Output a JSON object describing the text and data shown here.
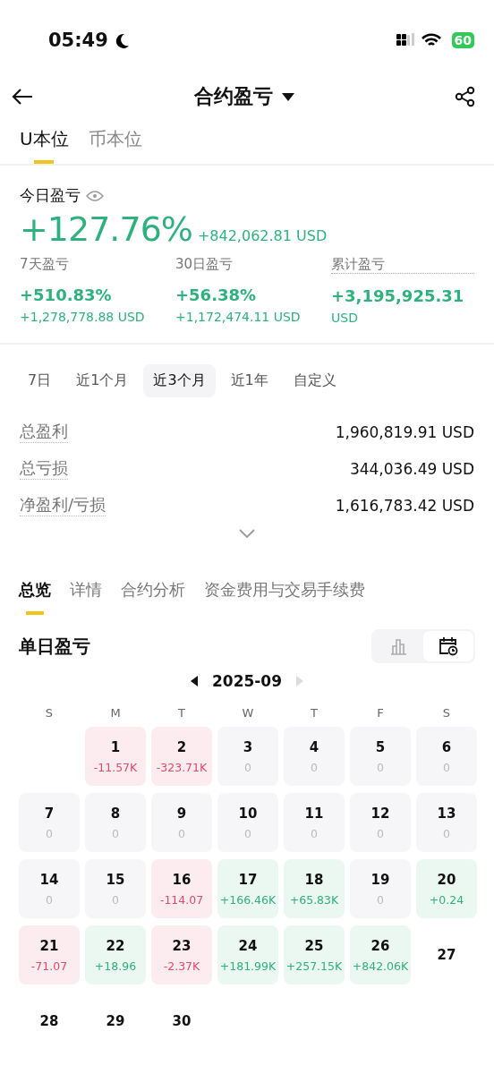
{
  "status_bar": {
    "time": "05:49",
    "battery": "60"
  },
  "header": {
    "title": "合约盈亏"
  },
  "unit_tabs": [
    {
      "label": "U本位",
      "selected": true
    },
    {
      "label": "币本位",
      "selected": false
    }
  ],
  "today": {
    "label": "今日盈亏",
    "percent": "+127.76%",
    "amount": "+842,062.81 USD"
  },
  "periods": [
    {
      "label": "7天盈亏",
      "value": "+510.83%",
      "sub": "+1,278,778.88 USD",
      "hint": false
    },
    {
      "label": "30日盈亏",
      "value": "+56.38%",
      "sub": "+1,172,474.11 USD",
      "hint": false
    },
    {
      "label": "累计盈亏",
      "value": "+3,195,925.31",
      "sub": "USD",
      "hint": true
    }
  ],
  "ranges": [
    {
      "label": "7日",
      "selected": false
    },
    {
      "label": "近1个月",
      "selected": false
    },
    {
      "label": "近3个月",
      "selected": true
    },
    {
      "label": "近1年",
      "selected": false
    },
    {
      "label": "自定义",
      "selected": false
    }
  ],
  "totals": [
    {
      "label": "总盈利",
      "value": "1,960,819.91 USD"
    },
    {
      "label": "总亏损",
      "value": "344,036.49 USD"
    },
    {
      "label": "净盈利/亏损",
      "value": "1,616,783.42 USD"
    }
  ],
  "section_tabs": [
    {
      "label": "总览",
      "selected": true
    },
    {
      "label": "详情",
      "selected": false
    },
    {
      "label": "合约分析",
      "selected": false
    },
    {
      "label": "资金费用与交易手续费",
      "selected": false
    }
  ],
  "daily": {
    "title": "单日盈亏",
    "views": [
      {
        "kind": "bar",
        "selected": false
      },
      {
        "kind": "calendar",
        "selected": true
      }
    ],
    "month": "2025-09",
    "weekdays": [
      "S",
      "M",
      "T",
      "W",
      "T",
      "F",
      "S"
    ],
    "days": [
      {
        "kind": "blank"
      },
      {
        "kind": "loss",
        "day": "1",
        "value": "-11.57K"
      },
      {
        "kind": "loss",
        "day": "2",
        "value": "-323.71K"
      },
      {
        "kind": "flat",
        "day": "3",
        "value": "0"
      },
      {
        "kind": "flat",
        "day": "4",
        "value": "0"
      },
      {
        "kind": "flat",
        "day": "5",
        "value": "0"
      },
      {
        "kind": "flat",
        "day": "6",
        "value": "0"
      },
      {
        "kind": "flat",
        "day": "7",
        "value": "0"
      },
      {
        "kind": "flat",
        "day": "8",
        "value": "0"
      },
      {
        "kind": "flat",
        "day": "9",
        "value": "0"
      },
      {
        "kind": "flat",
        "day": "10",
        "value": "0"
      },
      {
        "kind": "flat",
        "day": "11",
        "value": "0"
      },
      {
        "kind": "flat",
        "day": "12",
        "value": "0"
      },
      {
        "kind": "flat",
        "day": "13",
        "value": "0"
      },
      {
        "kind": "flat",
        "day": "14",
        "value": "0"
      },
      {
        "kind": "flat",
        "day": "15",
        "value": "0"
      },
      {
        "kind": "loss",
        "day": "16",
        "value": "-114.07"
      },
      {
        "kind": "gain",
        "day": "17",
        "value": "+166.46K"
      },
      {
        "kind": "gain",
        "day": "18",
        "value": "+65.83K"
      },
      {
        "kind": "flat",
        "day": "19",
        "value": "0"
      },
      {
        "kind": "gain",
        "day": "20",
        "value": "+0.24"
      },
      {
        "kind": "loss",
        "day": "21",
        "value": "-71.07"
      },
      {
        "kind": "gain",
        "day": "22",
        "value": "+18.96"
      },
      {
        "kind": "loss",
        "day": "23",
        "value": "-2.37K"
      },
      {
        "kind": "gain",
        "day": "24",
        "value": "+181.99K"
      },
      {
        "kind": "gain",
        "day": "25",
        "value": "+257.15K"
      },
      {
        "kind": "gain",
        "day": "26",
        "value": "+842.06K"
      },
      {
        "kind": "future",
        "day": "27"
      },
      {
        "kind": "future",
        "day": "28"
      },
      {
        "kind": "future",
        "day": "29"
      },
      {
        "kind": "future",
        "day": "30"
      }
    ]
  }
}
